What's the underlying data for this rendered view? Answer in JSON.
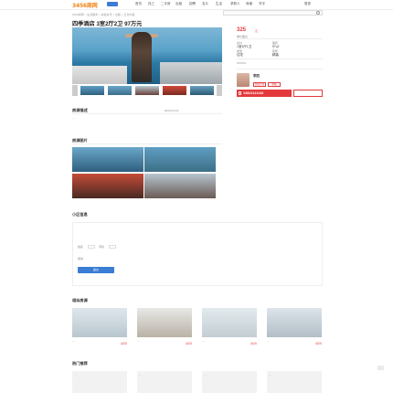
{
  "header": {
    "logo": "3456商网",
    "nav": [
      "首页",
      "找工",
      "二手房",
      "出租",
      "招聘",
      "名片",
      "生活",
      "求职人",
      "商铺",
      "写字",
      "登录"
    ]
  },
  "breadcrumb": "3456商网 > 生活服务 > 本地资讯 > 出租 > 正文内容",
  "listing": {
    "title": "四季酒店 3室2厅2卫 97万元",
    "price": "325",
    "price_unit": "元",
    "price_sub": "单价面议",
    "info": [
      {
        "label": "总价",
        "value": "1室1厅1卫"
      },
      {
        "label": "面积",
        "value": "97㎡"
      },
      {
        "label": "类型",
        "value": "住宅"
      },
      {
        "label": "装修",
        "value": "精装"
      }
    ],
    "address": "XXXXX"
  },
  "contact": {
    "name": "李四",
    "phone": "13821111126",
    "btn_chat": "在线咨询",
    "btn_fav": "收藏"
  },
  "sections": {
    "detail_title": "房源描述",
    "detail_date": "2023-01-15",
    "detail_text": "…",
    "images_title": "房源图片",
    "form_title": "小区信息",
    "related_title": "相似房源",
    "hot_title": "热门推荐"
  },
  "form": {
    "labels": [
      "姓名",
      "手机",
      "留言"
    ],
    "submit": "提交"
  },
  "related": [
    {
      "caption": "…",
      "price": "4200"
    },
    {
      "caption": "…",
      "price": "4100"
    },
    {
      "caption": "…",
      "price": "4100"
    },
    {
      "caption": "…",
      "price": "4200"
    }
  ],
  "hot": [
    {
      "caption": "…"
    },
    {
      "caption": "…"
    },
    {
      "caption": "…"
    },
    {
      "caption": "…"
    }
  ],
  "colors": {
    "accent_orange": "#f08519",
    "price_red": "#e4393c",
    "nav_blue": "#3b7cd4"
  }
}
